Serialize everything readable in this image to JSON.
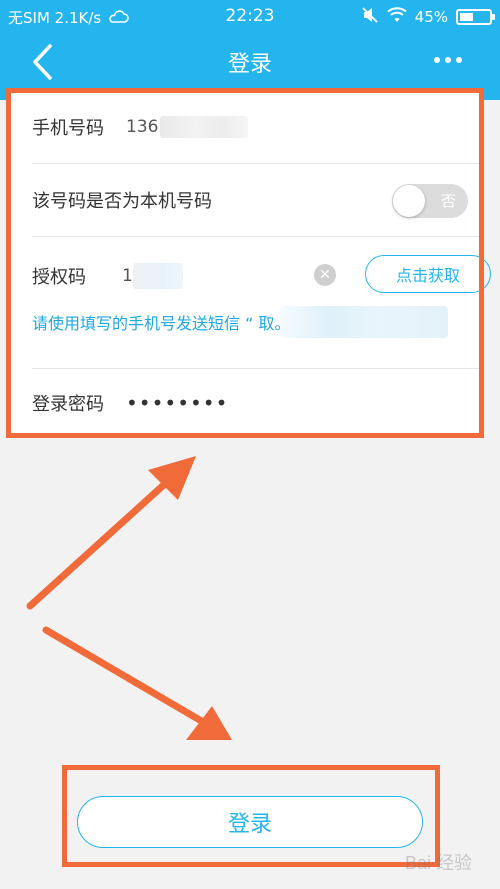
{
  "status_bar": {
    "carrier": "无SIM 2.1K/s",
    "time": "22:23",
    "battery": "45%",
    "battery_level": 0.45
  },
  "nav": {
    "title": "登录"
  },
  "form": {
    "phone_label": "手机号码",
    "phone_value": "136",
    "local_label": "该号码是否为本机号码",
    "toggle_text": "否",
    "auth_label": "授权码",
    "auth_value": "1",
    "get_code_label": "点击获取",
    "hint": "请使用填写的手机号发送短信 “                         取。",
    "password_label": "登录密码",
    "password_value": "••••••••"
  },
  "login_button": "登录",
  "watermark": "Bai 经验",
  "colors": {
    "accent": "#25b5ee",
    "highlight": "#f06a3a"
  }
}
